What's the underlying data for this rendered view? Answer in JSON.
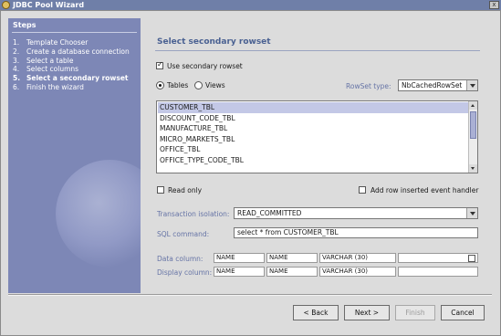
{
  "window": {
    "title": "JDBC Pool Wizard",
    "close_glyph": "x"
  },
  "steps": {
    "heading": "Steps",
    "items": [
      {
        "num": "1.",
        "label": "Template Chooser"
      },
      {
        "num": "2.",
        "label": "Create a database connection"
      },
      {
        "num": "3.",
        "label": "Select a table"
      },
      {
        "num": "4.",
        "label": "Select columns"
      },
      {
        "num": "5.",
        "label": "Select a secondary rowset"
      },
      {
        "num": "6.",
        "label": "Finish the wizard"
      }
    ]
  },
  "panel": {
    "title": "Select secondary rowset",
    "use_secondary_label": "Use secondary rowset",
    "tables_label": "Tables",
    "views_label": "Views",
    "rowset_type_label": "RowSet type:",
    "rowset_type_value": "NbCachedRowSet",
    "tables": [
      "CUSTOMER_TBL",
      "DISCOUNT_CODE_TBL",
      "MANUFACTURE_TBL",
      "MICRO_MARKETS_TBL",
      "OFFICE_TBL",
      "OFFICE_TYPE_CODE_TBL"
    ],
    "read_only_label": "Read only",
    "add_row_label": "Add row inserted event handler",
    "transaction_label": "Transaction isolation:",
    "transaction_value": "READ_COMMITTED",
    "sql_label": "SQL command:",
    "sql_value": "select * from CUSTOMER_TBL",
    "data_column_label": "Data column:",
    "display_column_label": "Display column:",
    "data_column": {
      "name": "NAME",
      "col2": "NAME",
      "type": "VARCHAR (30)"
    },
    "display_column": {
      "name": "NAME",
      "col2": "NAME",
      "type": "VARCHAR (30)"
    }
  },
  "buttons": {
    "back": "< Back",
    "next": "Next >",
    "finish": "Finish",
    "cancel": "Cancel"
  },
  "colors": {
    "steps_panel": "#7d87b6",
    "accent_label": "#6674a6",
    "title_bar": "#6f7fa8",
    "selected_row": "#c3c8e6"
  }
}
